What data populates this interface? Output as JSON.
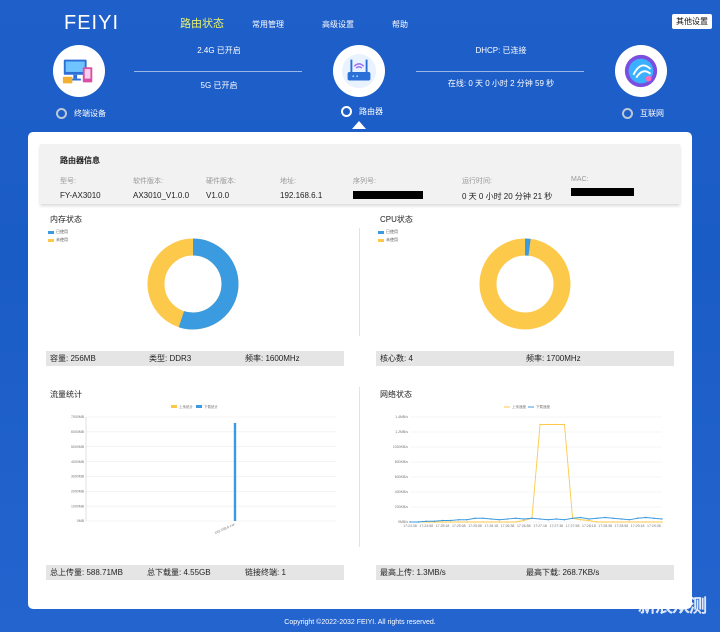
{
  "header": {
    "logo": "FEIYI",
    "nav": [
      "路由状态",
      "常用管理",
      "高级设置",
      "帮助"
    ],
    "advanced_button": "其他设置"
  },
  "status": {
    "wifi_24g": "2.4G 已开启",
    "wifi_5g": "5G 已开启",
    "dhcp": "DHCP: 已连接",
    "online": "在线: 0 天 0 小时 2 分钟 59 秒",
    "nodes": {
      "devices": "终端设备",
      "router": "路由器",
      "internet": "互联网"
    }
  },
  "router_info": {
    "title": "路由器信息",
    "labels": [
      "型号:",
      "软件版本:",
      "硬件版本:",
      "地址:",
      "序列号:",
      "运行时间:",
      "MAC:"
    ],
    "values": [
      "FY-AX3010",
      "AX3010_V1.0.0",
      "V1.0.0",
      "192.168.6.1",
      "",
      "0 天 0 小时 20 分钟 21 秒",
      ""
    ]
  },
  "memory": {
    "title": "内存状态",
    "legend": [
      "已使用",
      "未使用"
    ],
    "used_pct": 55,
    "stats": [
      "容量: 256MB",
      "类型: DDR3",
      "频率: 1600MHz"
    ]
  },
  "cpu": {
    "title": "CPU状态",
    "legend": [
      "已使用",
      "未使用"
    ],
    "used_pct": 2,
    "stats": [
      "核心数: 4",
      "频率: 1700MHz"
    ]
  },
  "traffic": {
    "title": "流量统计",
    "legend": [
      "上传统计",
      "下载统计"
    ],
    "stats": [
      "总上传量: 588.71MB",
      "总下载量: 4.55GB",
      "链接终端: 1"
    ]
  },
  "network": {
    "title": "网络状态",
    "legend": [
      "上传速度",
      "下载速度"
    ],
    "stats": [
      "最高上传: 1.3MB/s",
      "最高下载: 268.7KB/s"
    ]
  },
  "chart_data": [
    {
      "type": "pie",
      "title": "内存状态",
      "labels": [
        "已使用",
        "未使用"
      ],
      "values": [
        55,
        45
      ]
    },
    {
      "type": "pie",
      "title": "CPU状态",
      "labels": [
        "已使用",
        "未使用"
      ],
      "values": [
        2,
        98
      ]
    },
    {
      "type": "bar",
      "title": "流量统计",
      "categories": [
        "192.168.6.xxx"
      ],
      "series": [
        {
          "name": "上传统计",
          "values": [
            0
          ]
        },
        {
          "name": "下载统计",
          "values": [
            6600
          ]
        }
      ],
      "ylim": [
        0,
        7000
      ],
      "yticks": [
        "0MB",
        "1000MB",
        "2000MB",
        "3000MB",
        "4000MB",
        "5000MB",
        "6000MB",
        "7000MB"
      ]
    },
    {
      "type": "line",
      "title": "网络状态",
      "x": [
        "17:24:38",
        "17:24:48",
        "17:24:58",
        "17:25:08",
        "17:25:18",
        "17:25:28",
        "17:25:38",
        "17:25:48",
        "17:25:58",
        "17:26:08",
        "17:26:18",
        "17:26:28",
        "17:26:38",
        "17:26:48",
        "17:26:58",
        "17:27:08",
        "17:27:18",
        "17:27:28",
        "17:27:38",
        "17:27:48",
        "17:27:58",
        "17:28:08",
        "17:28:18",
        "17:28:28",
        "17:28:38",
        "17:28:48",
        "17:28:58",
        "17:29:08",
        "17:29:18",
        "17:29:28",
        "17:29:38",
        "17:29:48"
      ],
      "series": [
        {
          "name": "上传速度",
          "values": [
            0,
            0,
            0,
            0,
            0,
            0,
            0,
            0,
            0,
            0,
            0,
            0,
            0,
            0,
            0.02,
            0.05,
            1.3,
            1.3,
            1.3,
            1.3,
            0.05,
            0.03,
            0.02,
            0,
            0,
            0,
            0,
            0,
            0,
            0,
            0,
            0
          ]
        },
        {
          "name": "下载速度",
          "values": [
            0,
            0,
            0.01,
            0.01,
            0.02,
            0.02,
            0.03,
            0.03,
            0.05,
            0.05,
            0.04,
            0.03,
            0.04,
            0.05,
            0.04,
            0.05,
            0.04,
            0.03,
            0.04,
            0.03,
            0.05,
            0.06,
            0.04,
            0.05,
            0.06,
            0.05,
            0.04,
            0.03,
            0.05,
            0.06,
            0.05,
            0.04
          ]
        }
      ],
      "ylim": [
        0,
        1.4
      ],
      "yticks": [
        "0MB/s",
        "200KB/s",
        "400KB/s",
        "600KB/s",
        "800KB/s",
        "1000KB/s",
        "1.2MB/s",
        "1.4MB/s"
      ]
    }
  ],
  "footer": "Copyright ©2022-2032 FEIYI. All rights reserved.",
  "watermark": {
    "line1": "新浪",
    "line2": "众测"
  },
  "colors": {
    "accent": "#1f5fc9",
    "used": "#3b9be0",
    "free": "#fcc94a",
    "active_nav": "#e8f26b"
  }
}
